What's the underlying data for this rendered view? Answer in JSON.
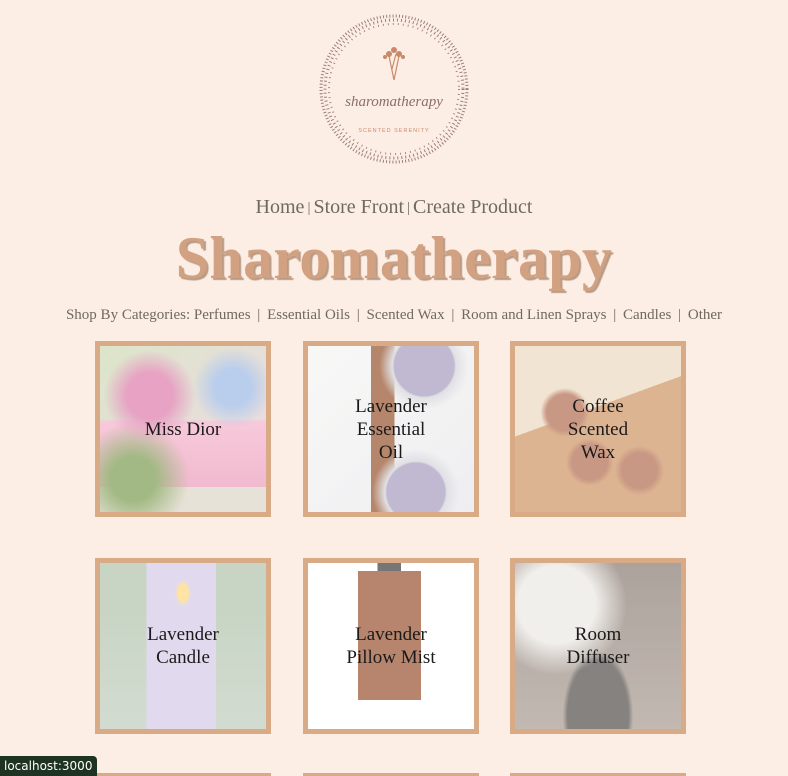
{
  "logo": {
    "script_text": "sharomatherapy",
    "tagline": "SCENTED SERENITY",
    "icon": "flower-sprig-icon"
  },
  "nav": {
    "items": [
      "Home",
      "Store Front",
      "Create Product"
    ],
    "separator": "|"
  },
  "brand": {
    "title": "Sharomatherapy"
  },
  "categories": {
    "prefix": "Shop By Categories:",
    "items": [
      "Perfumes",
      "Essential Oils",
      "Scented Wax",
      "Room and Linen Sprays",
      "Candles",
      "Other"
    ],
    "separator": "|"
  },
  "products": [
    {
      "name": "Miss Dior",
      "image": "perfume-bottle-flowers"
    },
    {
      "name": "Lavender Essential Oil",
      "image": "amber-dropper-bottle-lavender"
    },
    {
      "name": "Coffee Scented Wax",
      "image": "honeycomb-wax-melts"
    },
    {
      "name": "Lavender Candle",
      "image": "lavender-pillar-candle"
    },
    {
      "name": "Lavender Pillow Mist",
      "image": "pillow-ritual-spray-bottle"
    },
    {
      "name": "Room Diffuser",
      "image": "mist-diffuser"
    }
  ],
  "colors": {
    "background": "#fdeee5",
    "accent": "#d2a181",
    "border": "#d9aa86",
    "text": "#6f6a5c"
  },
  "status_bar": {
    "url": "localhost:3000"
  }
}
